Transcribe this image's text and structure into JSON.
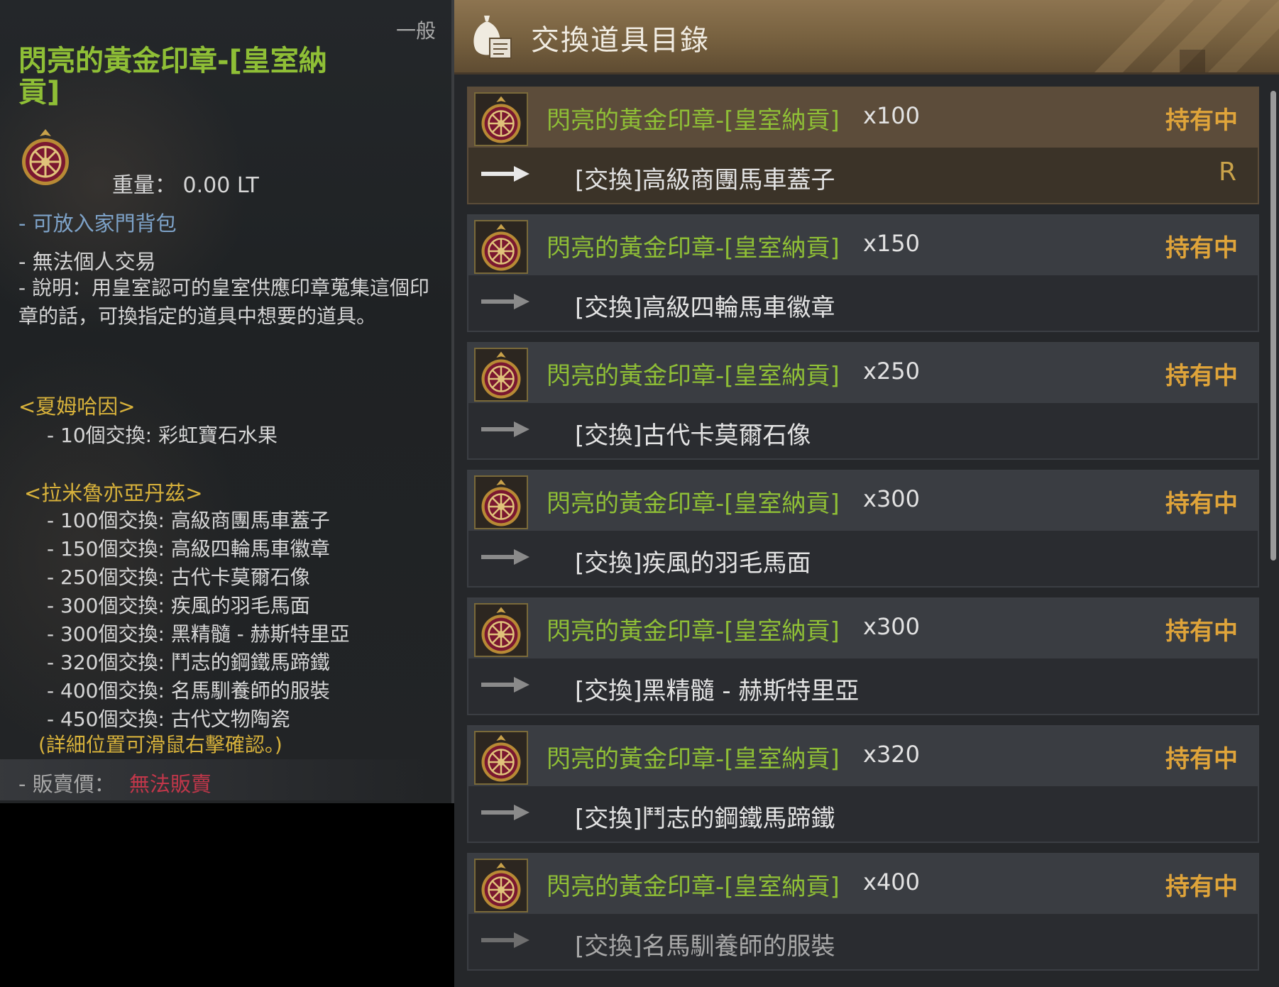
{
  "tooltip": {
    "grade": "一般",
    "item_name": "閃亮的黃金印章-[皇室納貢]",
    "icon": "royal-seal-icon",
    "weight_label": "重量：",
    "weight_value": "0.00 LT",
    "family_bag": "- 可放入家門背包",
    "no_trade": "- 無法個人交易",
    "description": "- 說明：用皇室認可的皇室供應印章蒐集這個印章的話，可換指定的道具中想要的道具。",
    "sections": [
      {
        "title": "<夏姆哈因>",
        "lines": [
          "- 10個交換: 彩虹寶石水果"
        ]
      },
      {
        "title": "<拉米魯亦亞丹茲>",
        "lines": [
          "- 100個交換: 高級商團馬車蓋子",
          "- 150個交換: 高級四輪馬車徽章",
          "- 250個交換: 古代卡莫爾石像",
          "- 300個交換: 疾風的羽毛馬面",
          "- 300個交換: 黑精髓 - 赫斯特里亞",
          "- 320個交換: 鬥志的鋼鐵馬蹄鐵",
          "- 400個交換: 名馬馴養師的服裝",
          "- 450個交換: 古代文物陶瓷"
        ]
      }
    ],
    "note": "(詳細位置可滑鼠右擊確認。)",
    "price_label": "- 販賣價：",
    "price_value": "無法販賣"
  },
  "exchange": {
    "title": "交換道具目錄",
    "header_icon": "item-bag-scroll-icon",
    "colors": {
      "req_name": "#8fbf36",
      "status": "#dfa43a",
      "header": "#7b6444"
    },
    "rows": [
      {
        "req_name": "閃亮的黃金印章-[皇室納貢]",
        "qty": "x100",
        "status": "持有中",
        "reward": "[交換]高級商團馬車蓋子",
        "rank": "R"
      },
      {
        "req_name": "閃亮的黃金印章-[皇室納貢]",
        "qty": "x150",
        "status": "持有中",
        "reward": "[交換]高級四輪馬車徽章",
        "rank": ""
      },
      {
        "req_name": "閃亮的黃金印章-[皇室納貢]",
        "qty": "x250",
        "status": "持有中",
        "reward": "[交換]古代卡莫爾石像",
        "rank": ""
      },
      {
        "req_name": "閃亮的黃金印章-[皇室納貢]",
        "qty": "x300",
        "status": "持有中",
        "reward": "[交換]疾風的羽毛馬面",
        "rank": ""
      },
      {
        "req_name": "閃亮的黃金印章-[皇室納貢]",
        "qty": "x300",
        "status": "持有中",
        "reward": "[交換]黑精髓 - 赫斯特里亞",
        "rank": ""
      },
      {
        "req_name": "閃亮的黃金印章-[皇室納貢]",
        "qty": "x320",
        "status": "持有中",
        "reward": "[交換]鬥志的鋼鐵馬蹄鐵",
        "rank": ""
      },
      {
        "req_name": "閃亮的黃金印章-[皇室納貢]",
        "qty": "x400",
        "status": "持有中",
        "reward": "[交換]名馬馴養師的服裝",
        "rank": ""
      }
    ]
  }
}
